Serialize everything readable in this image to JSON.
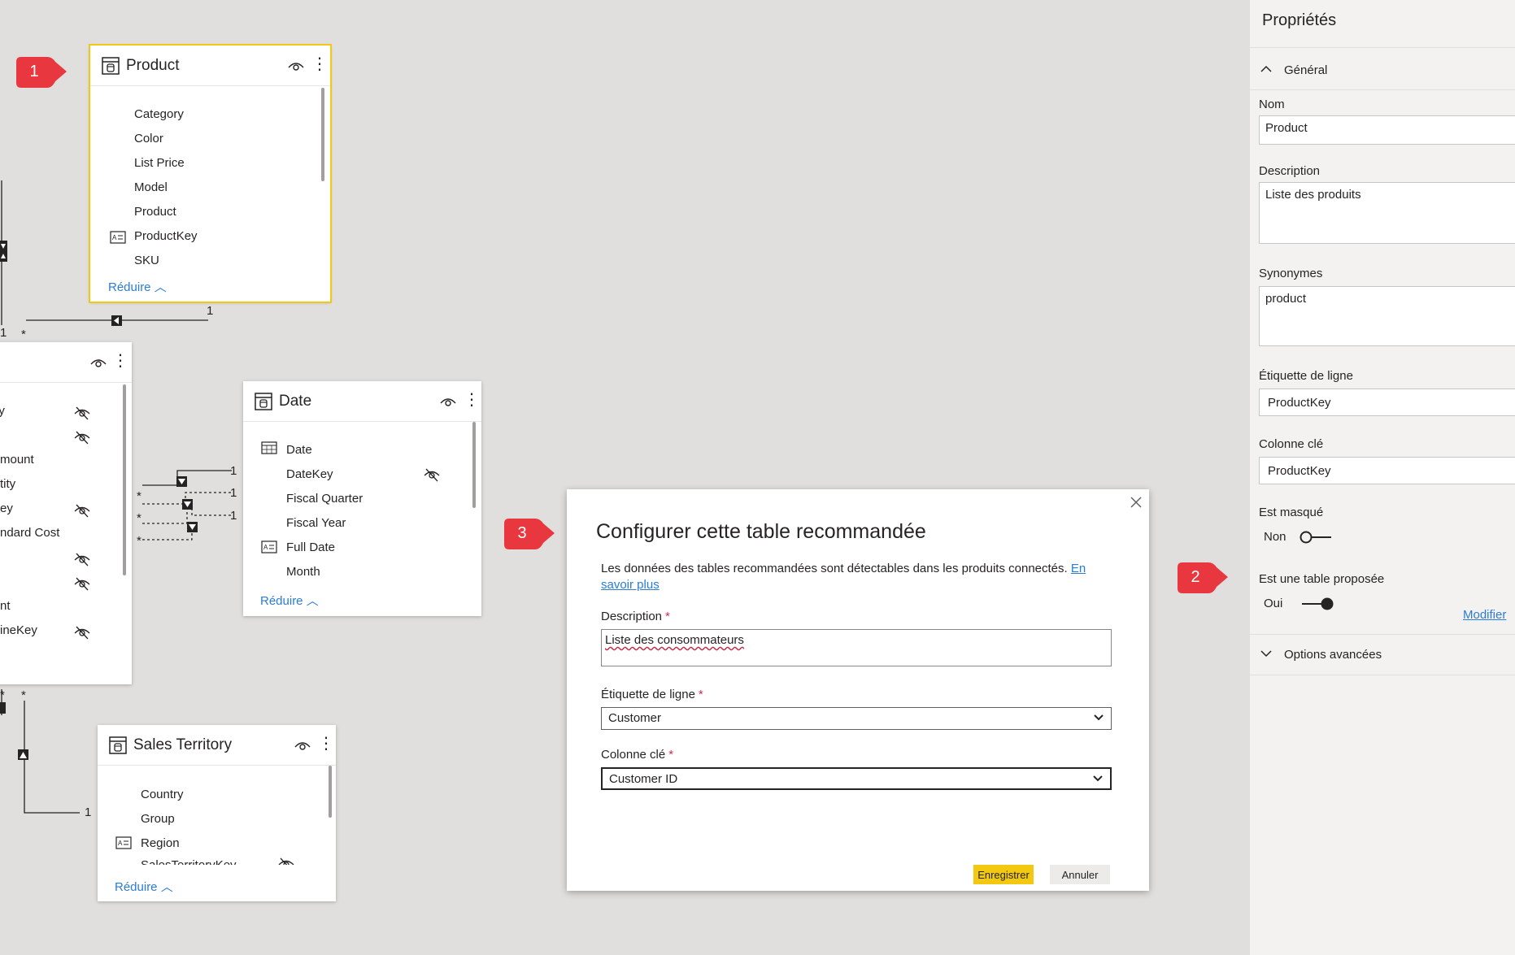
{
  "canvas": {
    "product_table": {
      "title": "Product",
      "fields": [
        "Category",
        "Color",
        "List Price",
        "Model",
        "Product",
        "ProductKey",
        "SKU"
      ],
      "collapse_label": "Réduire"
    },
    "sales_table": {
      "fields": [
        "ey",
        "y",
        "mount",
        "tity",
        "ey",
        "ndard Cost",
        "",
        "",
        "nt",
        "ineKey"
      ]
    },
    "date_table": {
      "title": "Date",
      "fields": [
        "Date",
        "DateKey",
        "Fiscal Quarter",
        "Fiscal Year",
        "Full Date",
        "Month"
      ],
      "collapse_label": "Réduire"
    },
    "territory_table": {
      "title": "Sales Territory",
      "fields": [
        "Country",
        "Group",
        "Region",
        "SalesTerritoryKey"
      ],
      "collapse_label": "Réduire"
    },
    "relation_labels": {
      "one": "1",
      "many": "*"
    }
  },
  "callouts": [
    "1",
    "2",
    "3"
  ],
  "dialog": {
    "title": "Configurer cette table recommandée",
    "description_text": "Les données des tables recommandées sont détectables dans les produits connectés. ",
    "learn_more": "En savoir plus",
    "description_label": "Description",
    "description_value": "Liste des consommateurs",
    "row_label_label": "Étiquette de ligne",
    "row_label_value": "Customer",
    "key_column_label": "Colonne clé",
    "key_column_value": "Customer ID",
    "required_mark": "*",
    "save_label": "Enregistrer",
    "cancel_label": "Annuler"
  },
  "properties": {
    "title": "Propriétés",
    "general_section": "Général",
    "name_label": "Nom",
    "name_value": "Product",
    "description_label": "Description",
    "description_value": "Liste des produits",
    "synonyms_label": "Synonymes",
    "synonyms_value": "product",
    "row_label_label": "Étiquette de ligne",
    "row_label_value": "ProductKey",
    "key_column_label": "Colonne clé",
    "key_column_value": "ProductKey",
    "hidden_label": "Est masqué",
    "hidden_value": "Non",
    "featured_label": "Est une table proposée",
    "featured_value": "Oui",
    "modify_label": "Modifier",
    "advanced_section": "Options avancées"
  },
  "colors": {
    "accent_yellow": "#f2c811",
    "link_blue": "#2b7cd3",
    "callout_red": "#e8373e",
    "required_red": "#c4314b"
  }
}
